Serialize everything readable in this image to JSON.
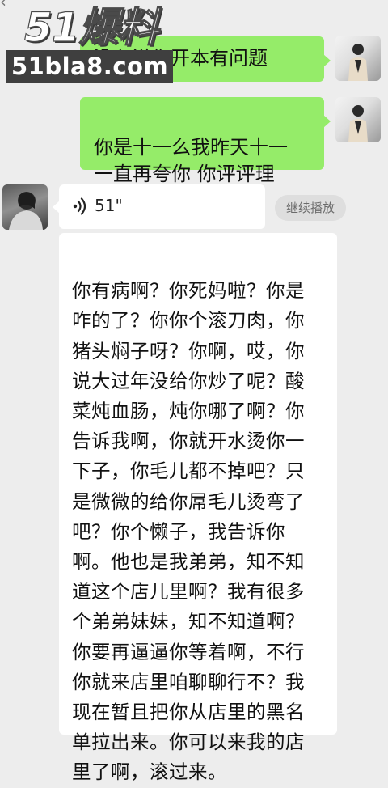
{
  "watermark": {
    "top_text": "51爆料",
    "bottom_text": "51bla8.com"
  },
  "messages": [
    {
      "side": "right",
      "text": "没有说你开本有问题",
      "avatar_icon": "user-avatar-icon"
    },
    {
      "side": "right",
      "text": "你是十一么我昨天十一\n一直再夸你 你评评理",
      "avatar_icon": "user-avatar-icon"
    }
  ],
  "voice_message": {
    "icon": "voice-wave-icon",
    "duration": "51\"",
    "continue_label": "继续播放"
  },
  "transcript": {
    "text": "你有病啊？你死妈啦？你是\n咋的了？你你个滚刀肉，你\n猪头焖子呀？你啊，哎，你\n说大过年没给你炒了呢？酸\n菜炖血肠，炖你哪了啊？你\n告诉我啊，你就开水烫你一\n下子，你毛儿都不掉吧？只\n是微微的给你屌毛儿烫弯了\n吧？你个懒子，我告诉你\n啊。他也是我弟弟，知不知\n道这个店儿里啊？我有很多\n个弟弟妹妹，知不知道啊？\n你要再逼逼你等着啊，不行\n你就来店里咱聊聊行不？我\n现在暂且把你从店里的黑名\n单拉出来。你可以来我的店\n里了啊，滚过来。"
  },
  "contact": {
    "avatar_icon": "contact-avatar-icon"
  },
  "colors": {
    "background": "#ededed",
    "sent_bubble": "#95ec69",
    "received_bubble": "#ffffff",
    "continue_button": "#dedede"
  }
}
